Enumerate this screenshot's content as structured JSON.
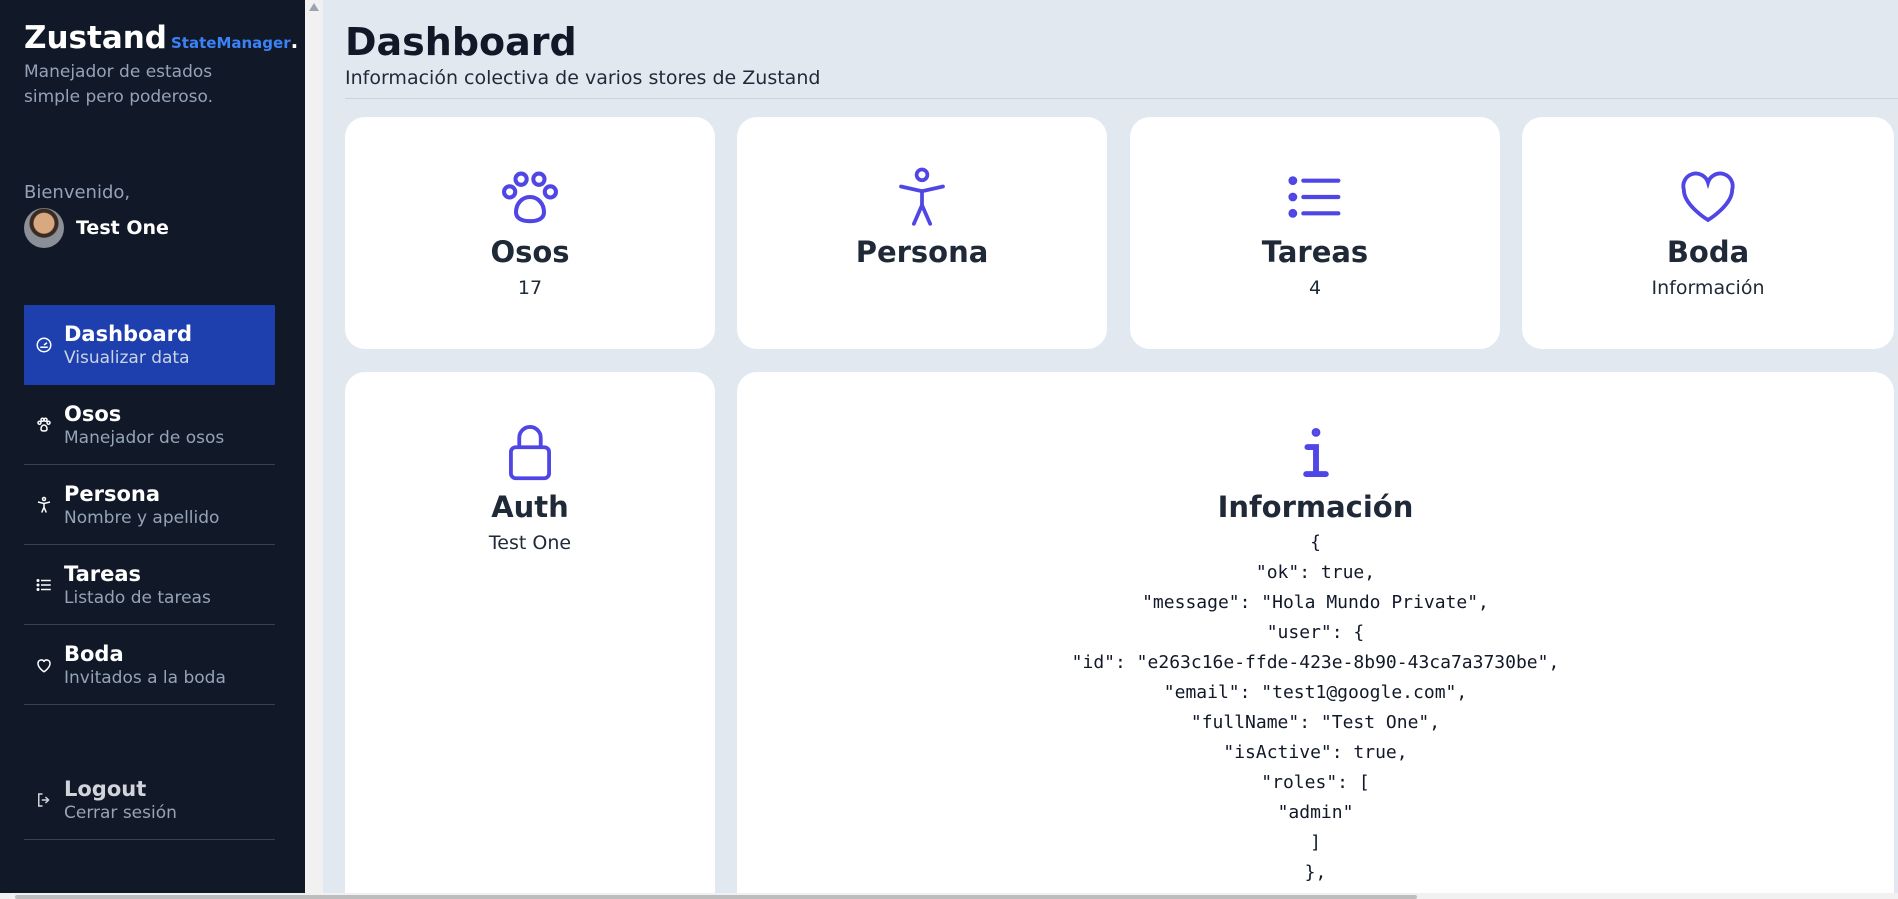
{
  "brand": {
    "title": "Zustand",
    "sub": "StateManager",
    "dot": ".",
    "tagline": "Manejador de estados simple pero poderoso."
  },
  "user": {
    "welcome": "Bienvenido,",
    "name": "Test One"
  },
  "nav": [
    {
      "title": "Dashboard",
      "desc": "Visualizar data",
      "icon": "gauge-icon",
      "active": true
    },
    {
      "title": "Osos",
      "desc": "Manejador de osos",
      "icon": "paw-icon"
    },
    {
      "title": "Persona",
      "desc": "Nombre y apellido",
      "icon": "person-icon"
    },
    {
      "title": "Tareas",
      "desc": "Listado de tareas",
      "icon": "list-icon"
    },
    {
      "title": "Boda",
      "desc": "Invitados a la boda",
      "icon": "heart-icon"
    }
  ],
  "logout": {
    "title": "Logout",
    "desc": "Cerrar sesión",
    "icon": "logout-icon"
  },
  "page": {
    "title": "Dashboard",
    "subtitle": "Información colectiva de varios stores de Zustand"
  },
  "cards": [
    {
      "title": "Osos",
      "value": "17",
      "icon": "paw-icon"
    },
    {
      "title": "Persona",
      "value": "",
      "icon": "person-icon"
    },
    {
      "title": "Tareas",
      "value": "4",
      "icon": "list-icon"
    },
    {
      "title": "Boda",
      "value": "Información",
      "icon": "heart-icon"
    },
    {
      "title": "Auth",
      "value": "Test One",
      "icon": "lock-icon"
    }
  ],
  "info": {
    "title": "Información",
    "icon": "info-icon",
    "json_lines": [
      "{",
      "\"ok\": true,",
      "\"message\": \"Hola Mundo Private\",",
      "\"user\": {",
      "\"id\": \"e263c16e-ffde-423e-8b90-43ca7a3730be\",",
      "\"email\": \"test1@google.com\",",
      "\"fullName\": \"Test One\",",
      "\"isActive\": true,",
      "\"roles\": [",
      "\"admin\"",
      "]",
      "},"
    ]
  },
  "colors": {
    "sidebar": "#111827",
    "active": "#1e40af",
    "accent": "#4f46e5",
    "brandSub": "#3b82f6"
  }
}
